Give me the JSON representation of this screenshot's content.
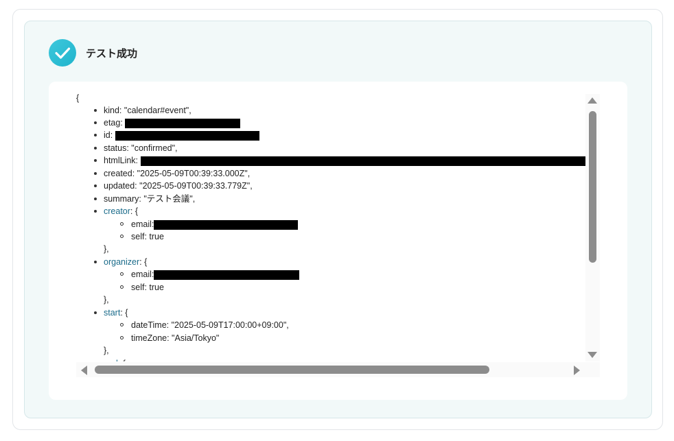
{
  "header": {
    "title": "テスト成功"
  },
  "json_view": {
    "open_brace": "{",
    "kind": "kind: \"calendar#event\",",
    "etag": "etag: ",
    "id": "id: ",
    "status": "status: \"confirmed\",",
    "htmlLink": "htmlLink: ",
    "created": "created: \"2025-05-09T00:39:33.000Z\",",
    "updated": "updated: \"2025-05-09T00:39:33.779Z\",",
    "summary": "summary: \"テスト会議\",",
    "creator_key": "creator",
    "creator_open": ": {",
    "creator_email": "email:",
    "creator_self": "self: true",
    "creator_close": "},",
    "organizer_key": "organizer",
    "organizer_open": ": {",
    "organizer_email": "email:",
    "organizer_self": "self: true",
    "organizer_close": "},",
    "start_key": "start",
    "start_open": ": {",
    "start_datetime": "dateTime: \"2025-05-09T17:00:00+09:00\",",
    "start_timezone": "timeZone: \"Asia/Tokyo\"",
    "start_close": "},",
    "end_key": "end",
    "end_open": ": {"
  }
}
